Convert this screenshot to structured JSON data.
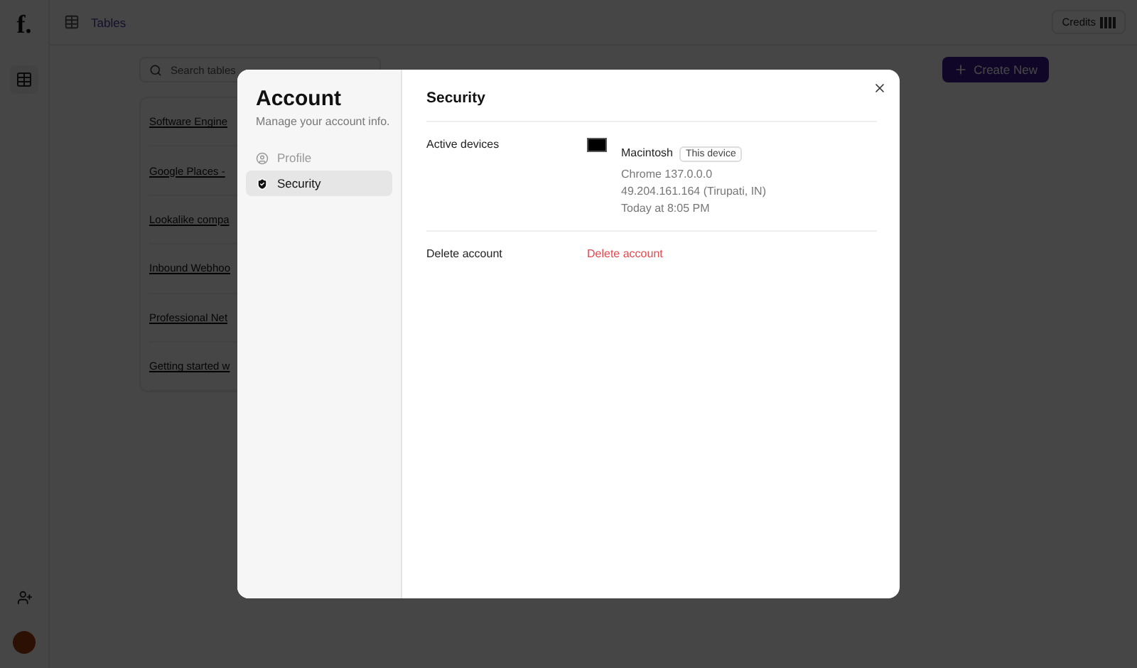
{
  "app": {
    "logo": "f.",
    "breadcrumb": "Tables",
    "credits": "Credits"
  },
  "toolbar": {
    "search_placeholder": "Search tables",
    "create_button": "Create New"
  },
  "tables": [
    {
      "name": "Software Engine"
    },
    {
      "name": "Google Places -"
    },
    {
      "name": "Lookalike compa"
    },
    {
      "name": "Inbound Webhoo"
    },
    {
      "name": "Professional Net"
    },
    {
      "name": "Getting started w"
    }
  ],
  "modal": {
    "title": "Account",
    "subtitle": "Manage your account info.",
    "nav": [
      {
        "label": "Profile",
        "selected": false
      },
      {
        "label": "Security",
        "selected": true
      }
    ],
    "section_title": "Security",
    "rows": [
      {
        "kind": "devices",
        "label": "Active devices",
        "device": {
          "name": "Macintosh",
          "badge": "This device",
          "lines": [
            "Chrome 137.0.0.0",
            "49.204.161.164 (Tirupati, IN)",
            "Today at 8:05 PM"
          ]
        }
      },
      {
        "kind": "action",
        "label": "Delete account",
        "action": "Delete account"
      }
    ]
  }
}
